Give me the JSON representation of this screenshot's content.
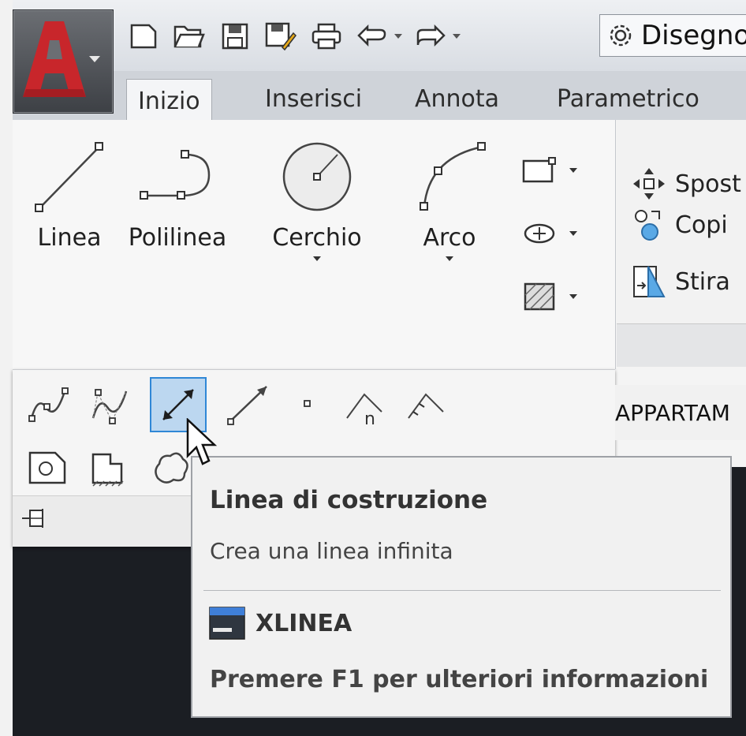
{
  "quick_access": {
    "workspace_label": "Disegno",
    "icons": [
      "new-icon",
      "open-icon",
      "save-icon",
      "save-as-icon",
      "plot-icon",
      "undo-icon",
      "redo-icon",
      "gear-icon"
    ]
  },
  "tabs": [
    {
      "label": "Inizio",
      "active": true
    },
    {
      "label": "Inserisci",
      "active": false
    },
    {
      "label": "Annota",
      "active": false
    },
    {
      "label": "Parametrico",
      "active": false
    }
  ],
  "draw_panel": {
    "tools": [
      {
        "label": "Linea"
      },
      {
        "label": "Polilinea"
      },
      {
        "label": "Cerchio"
      },
      {
        "label": "Arco"
      }
    ]
  },
  "modify_panel": {
    "items": [
      {
        "label": "Spost"
      },
      {
        "label": "Copi"
      },
      {
        "label": "Stira"
      }
    ]
  },
  "file_tab": {
    "label": "APPARTAM"
  },
  "tooltip": {
    "title": "Linea di costruzione",
    "description": "Crea una linea infinita",
    "command": "XLINEA",
    "help": "Premere F1 per ulteriori informazioni"
  },
  "colors": {
    "accent": "#2f87d6",
    "brand_red": "#c8262b"
  }
}
